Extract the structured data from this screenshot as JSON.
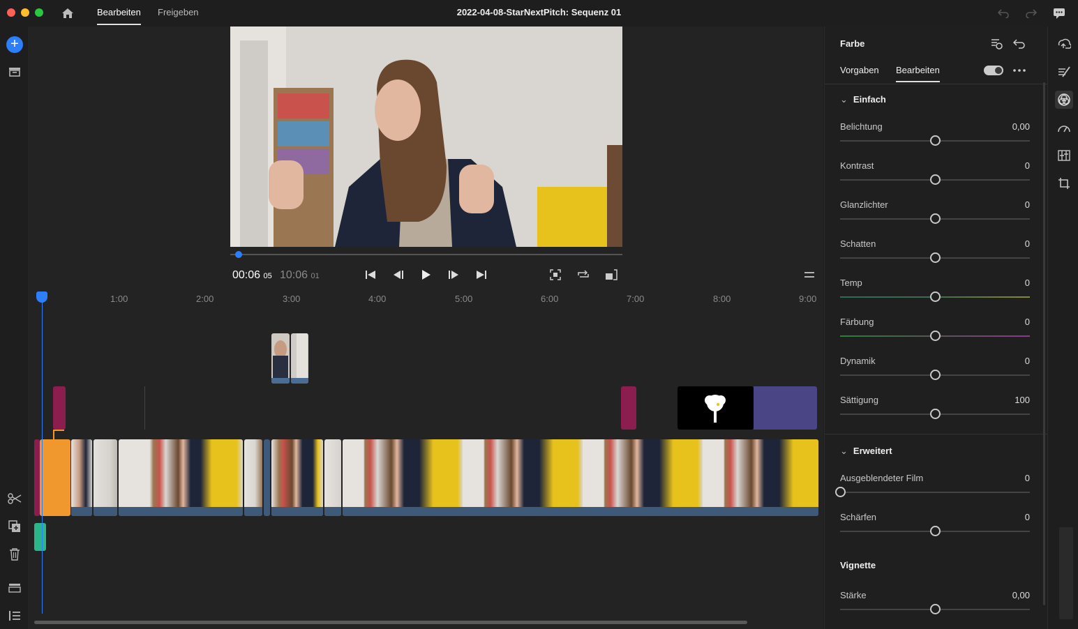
{
  "window": {
    "title": "2022-04-08-StarNextPitch: Sequenz 01",
    "tabs": [
      {
        "label": "Bearbeiten",
        "active": true
      },
      {
        "label": "Freigeben",
        "active": false
      }
    ]
  },
  "player": {
    "current_time": "00:06",
    "current_frames": "05",
    "total_time": "10:06",
    "total_frames": "01",
    "progress": 0.02
  },
  "timeline": {
    "ruler": [
      "1:00",
      "2:00",
      "3:00",
      "4:00",
      "5:00",
      "6:00",
      "7:00",
      "8:00",
      "9:00"
    ]
  },
  "panel": {
    "title": "Farbe",
    "tabs": [
      {
        "label": "Vorgaben"
      },
      {
        "label": "Bearbeiten",
        "active": true
      }
    ],
    "sections": {
      "basic": "Einfach",
      "advanced": "Erweitert",
      "vignette": "Vignette"
    },
    "sliders": [
      {
        "label": "Belichtung",
        "value": "0,00",
        "level": 0.5
      },
      {
        "label": "Kontrast",
        "value": "0",
        "level": 0.5
      },
      {
        "label": "Glanzlichter",
        "value": "0",
        "level": 0.5
      },
      {
        "label": "Schatten",
        "value": "0",
        "level": 0.5
      },
      {
        "label": "Temp",
        "value": "0",
        "level": 0.5
      },
      {
        "label": "Färbung",
        "value": "0",
        "level": 0.5
      },
      {
        "label": "Dynamik",
        "value": "0",
        "level": 0.5
      },
      {
        "label": "Sättigung",
        "value": "100",
        "level": 0.5
      },
      {
        "label": "Ausgeblendeter Film",
        "value": "0",
        "level": 0.0
      },
      {
        "label": "Schärfen",
        "value": "0",
        "level": 0.5
      },
      {
        "label": "Stärke",
        "value": "0,00",
        "level": 0.5
      }
    ]
  },
  "colors": {
    "accent": "#2d7ff9",
    "title_clip": "#8b1d4f",
    "selected_clip": "#f0982e",
    "audio_clip": "#2bb58a",
    "graphic_clip": "#4a4585"
  }
}
